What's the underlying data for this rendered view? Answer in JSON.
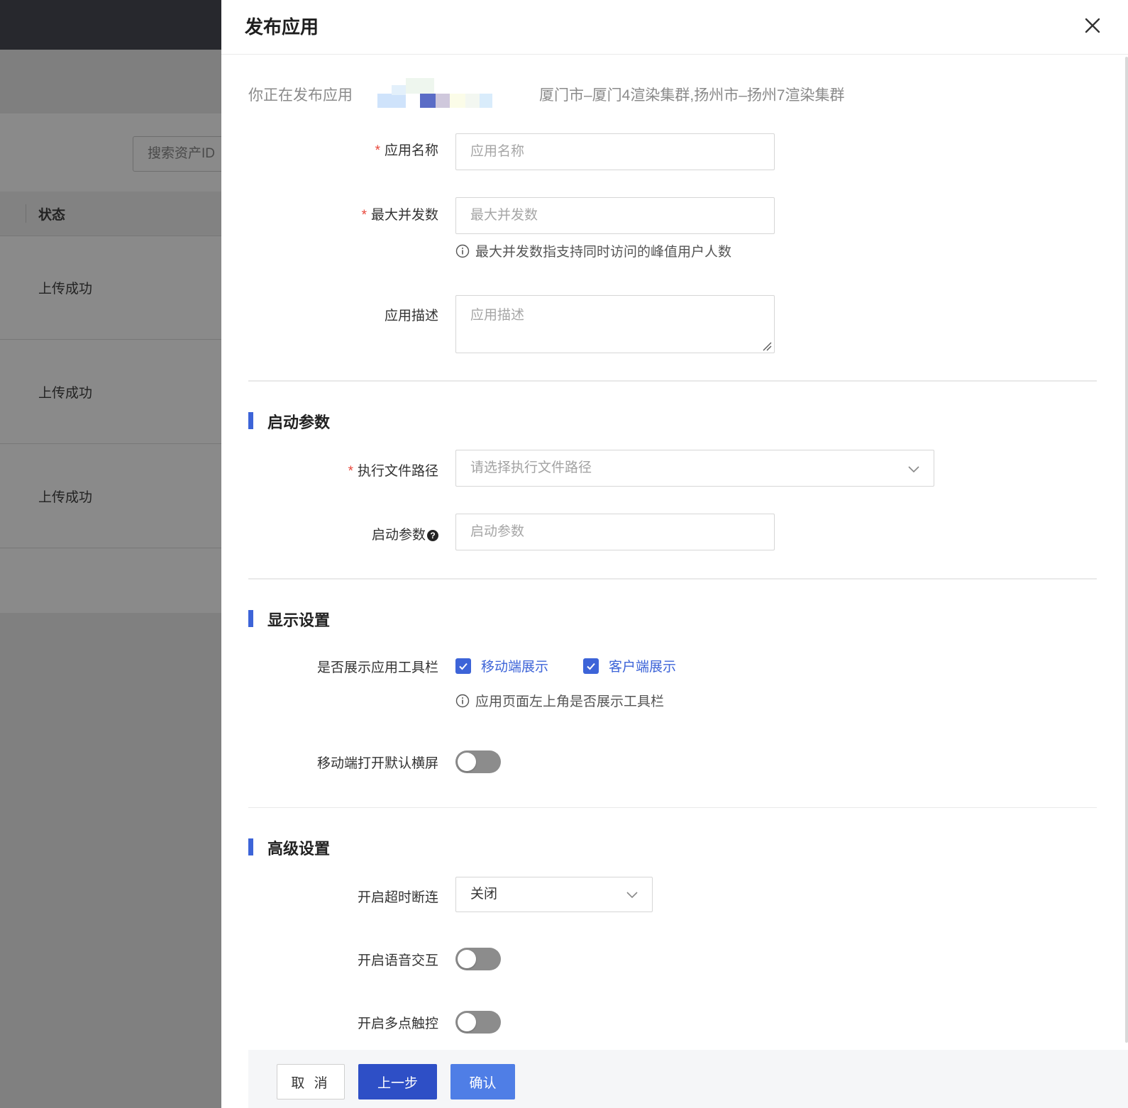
{
  "background": {
    "search_placeholder": "搜索资产ID",
    "table_header": "状态",
    "rows": [
      "上传成功",
      "上传成功",
      "上传成功"
    ]
  },
  "drawer": {
    "title": "发布应用",
    "intro_prefix": "你正在发布应用",
    "clusters": "厦门市–厦门4渲染集群,扬州市–扬州7渲染集群"
  },
  "form": {
    "app_name": {
      "label": "应用名称",
      "placeholder": "应用名称",
      "required": true
    },
    "max_concurrency": {
      "label": "最大并发数",
      "placeholder": "最大并发数",
      "required": true,
      "hint": "最大并发数指支持同时访问的峰值用户人数"
    },
    "description": {
      "label": "应用描述",
      "placeholder": "应用描述"
    }
  },
  "startup": {
    "section_title": "启动参数",
    "exec_path": {
      "label": "执行文件路径",
      "placeholder": "请选择执行文件路径",
      "required": true
    },
    "params": {
      "label": "启动参数",
      "placeholder": "启动参数",
      "help": "?"
    }
  },
  "display": {
    "section_title": "显示设置",
    "toolbar": {
      "label": "是否展示应用工具栏",
      "options": [
        {
          "label": "移动端展示",
          "checked": true
        },
        {
          "label": "客户端展示",
          "checked": true
        }
      ],
      "hint": "应用页面左上角是否展示工具栏"
    },
    "landscape": {
      "label": "移动端打开默认横屏",
      "on": false
    }
  },
  "advanced": {
    "section_title": "高级设置",
    "timeout": {
      "label": "开启超时断连",
      "value": "关闭"
    },
    "voice": {
      "label": "开启语音交互",
      "on": false
    },
    "multitouch": {
      "label": "开启多点触控",
      "on": false
    }
  },
  "footer": {
    "cancel": "取 消",
    "prev": "上一步",
    "confirm": "确认"
  },
  "colors": {
    "accent": "#3d64d8",
    "required": "#e8473b",
    "toggle_off": "#8c8c8c",
    "prev_button": "#2e4fc6",
    "confirm_button": "#4f7ee6"
  }
}
